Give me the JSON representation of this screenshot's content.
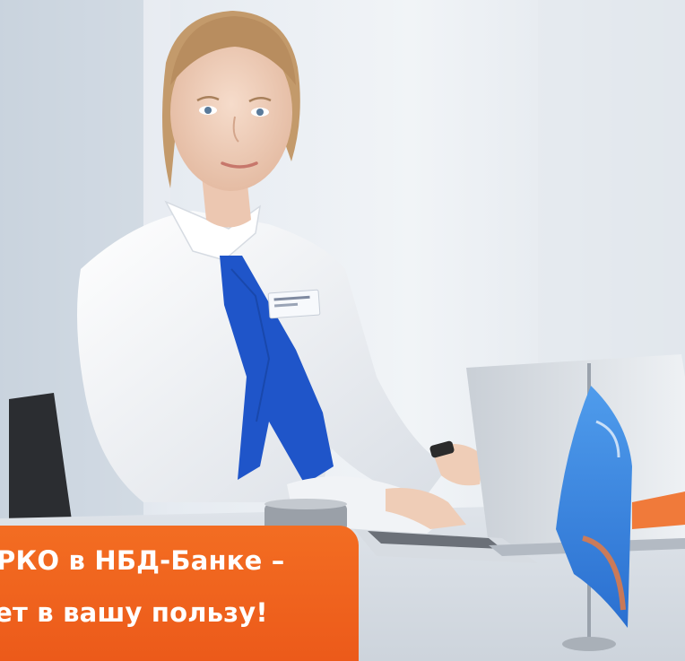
{
  "banner": {
    "line1": "РКО в НБД-Банке –",
    "line2": "чет в вашу пользу!",
    "color": "#f0631e"
  },
  "colors": {
    "tie": "#1f55c9",
    "flag": "#3a86e0",
    "shirt": "#f4f6f9",
    "background": "#eef1f5"
  }
}
